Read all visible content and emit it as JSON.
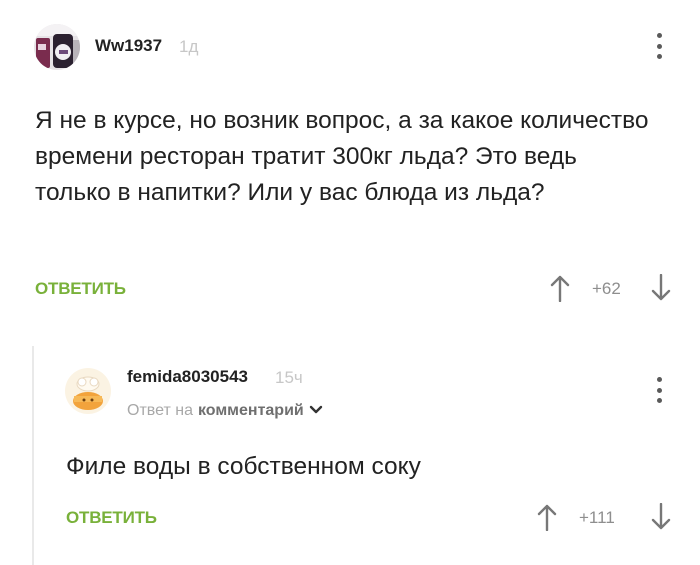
{
  "comments": [
    {
      "username": "Ww1937",
      "age": "1д",
      "text": "Я не в курсе, но возник вопрос, а за какое количество времени ресторан тратит 300кг льда? Это ведь только в напитки? Или у вас блюда из льда?",
      "reply_label": "ОТВЕТИТЬ",
      "score": "+62"
    },
    {
      "username": "femida8030543",
      "age": "15ч",
      "reply_to_prefix": "Ответ на",
      "reply_to_link": "комментарий",
      "text": "Филе воды в собственном соку",
      "reply_label": "ОТВЕТИТЬ",
      "score": "+111"
    }
  ],
  "icons": {
    "upvote": "arrow-up-icon",
    "downvote": "arrow-down-icon",
    "more": "more-vertical-icon",
    "expand": "chevron-down-icon"
  },
  "colors": {
    "accent": "#79b13a",
    "muted": "#c7c7c7",
    "text": "#222222"
  }
}
